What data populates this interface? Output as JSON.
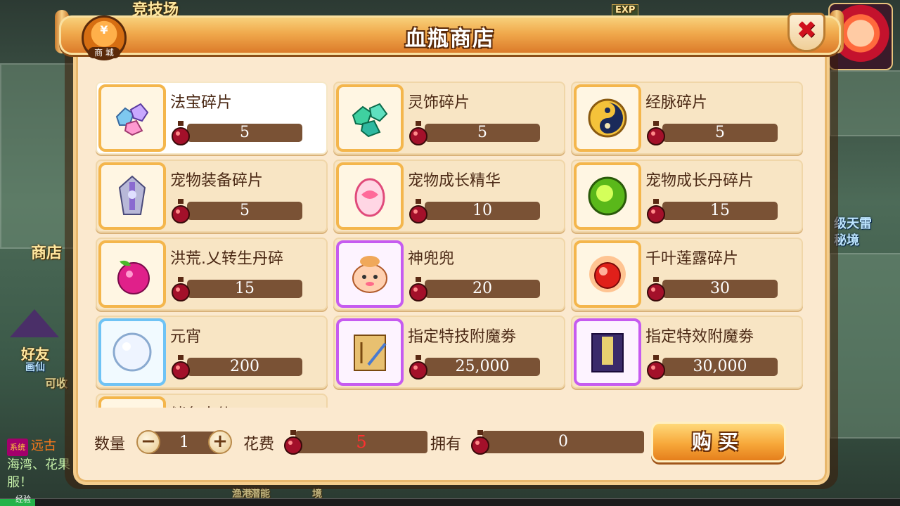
{
  "background": {
    "arena_label": "竞技场",
    "shop_label": "商店",
    "friends_label": "好友",
    "right_labels": [
      "级天雷",
      "秘境"
    ],
    "left_faint": "画仙",
    "left_faint2": "可收",
    "bottom_faint": [
      "渔港",
      "潜能",
      "境"
    ],
    "exp_label": "经验",
    "exp_badge": "EXP"
  },
  "chat": {
    "sys_tag": "系统",
    "line1_highlight": "远古",
    "line2": "海湾、花果",
    "line3": "服！"
  },
  "shop": {
    "title": "血瓶商店",
    "mall_label": "商 城",
    "mall_symbol": "¥",
    "close_symbol": "✖",
    "currency_icon": "blood-bottle-icon",
    "items": [
      {
        "name": "法宝碎片",
        "cost": "5",
        "icon": "gem-fragments-icon",
        "frame": "gold",
        "selected": true
      },
      {
        "name": "灵饰碎片",
        "cost": "5",
        "icon": "green-gem-fragments-icon",
        "frame": "gold"
      },
      {
        "name": "经脉碎片",
        "cost": "5",
        "icon": "yin-yang-icon",
        "frame": "gold"
      },
      {
        "name": "宠物装备碎片",
        "cost": "5",
        "icon": "silver-emblem-icon",
        "frame": "gold"
      },
      {
        "name": "宠物成长精华",
        "cost": "10",
        "icon": "pink-egg-icon",
        "frame": "gold"
      },
      {
        "name": "宠物成长丹碎片",
        "cost": "15",
        "icon": "green-orb-icon",
        "frame": "gold"
      },
      {
        "name": "洪荒.乂转生丹碎",
        "cost": "15",
        "icon": "magenta-fruit-icon",
        "frame": "gold"
      },
      {
        "name": "神兜兜",
        "cost": "20",
        "icon": "lucky-bag-icon",
        "frame": "purple"
      },
      {
        "name": "千叶莲露碎片",
        "cost": "30",
        "icon": "red-orb-icon",
        "frame": "gold"
      },
      {
        "name": "元宵",
        "cost": "200",
        "icon": "snowball-icon",
        "frame": "blue"
      },
      {
        "name": "指定特技附魔劵",
        "cost": "25,000",
        "icon": "gold-scroll-icon",
        "frame": "purple"
      },
      {
        "name": "指定特效附魔劵",
        "cost": "30,000",
        "icon": "purple-book-icon",
        "frame": "purple"
      },
      {
        "name": "储备大仙",
        "cost": "",
        "icon": "partial-item-icon",
        "frame": "gold"
      }
    ],
    "quantity_label": "数量",
    "quantity_value": "1",
    "minus_symbol": "−",
    "plus_symbol": "+",
    "cost_label": "花费",
    "cost_value": "5",
    "owned_label": "拥有",
    "owned_value": "0",
    "buy_label": "购买"
  },
  "colors": {
    "panel_bg": "#fbe9cf",
    "title_orange": "#f0a94c",
    "cost_bar": "#7a5235",
    "selected_bg": "#ffffff",
    "close_red": "#d0111d"
  }
}
